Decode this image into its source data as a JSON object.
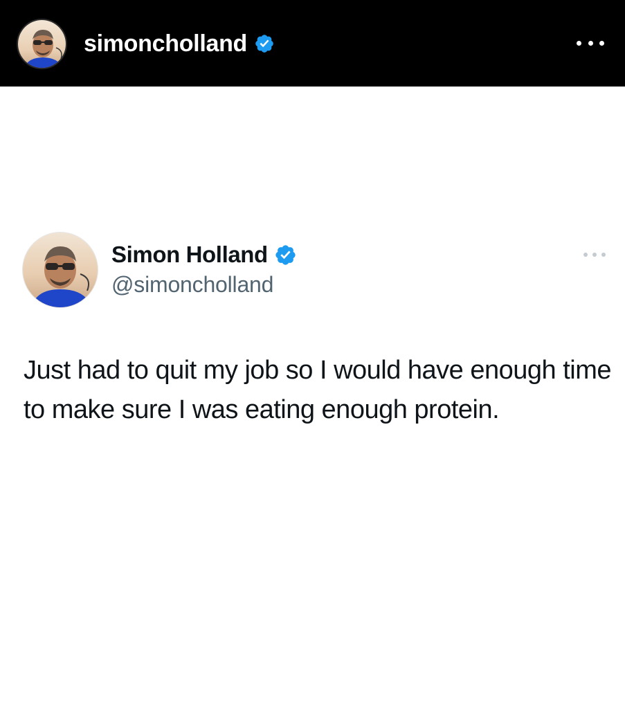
{
  "header": {
    "username": "simoncholland",
    "verified": true,
    "more_icon": "more-horizontal-icon",
    "background": "#000000"
  },
  "tweet": {
    "display_name": "Simon Holland",
    "handle": "@simoncholland",
    "verified": true,
    "text": "Just had to quit my job so I would have enough time to make sure I was eating enough protein.",
    "more_icon": "more-horizontal-icon"
  },
  "colors": {
    "verified_blue": "#1d9bf0",
    "name_text": "#0f1419",
    "handle_text": "#536471"
  }
}
